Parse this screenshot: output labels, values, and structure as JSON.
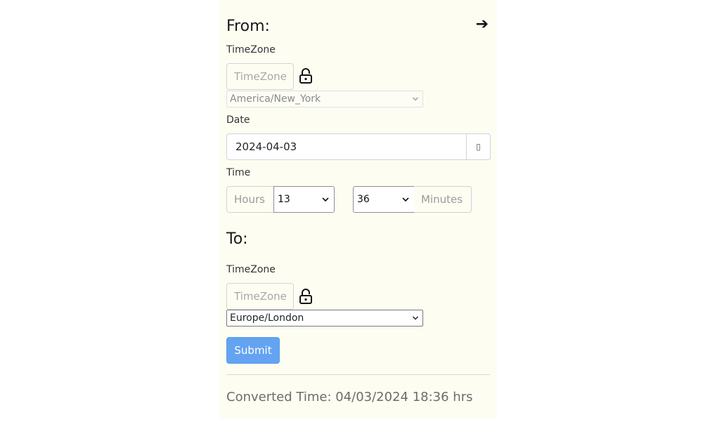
{
  "from": {
    "heading": "From:",
    "arrow": "➔",
    "timezone_label": "TimeZone",
    "timezone_input_placeholder": "TimeZone",
    "timezone_selected": "America/New_York",
    "date_label": "Date",
    "date_value": "2024-04-03",
    "date_button": "▯",
    "time_label": "Time",
    "hours_addon": "Hours",
    "hours_value": "13",
    "minutes_value": "36",
    "minutes_addon": "Minutes"
  },
  "to": {
    "heading": "To:",
    "timezone_label": "TimeZone",
    "timezone_input_placeholder": "TimeZone",
    "timezone_selected": "Europe/London"
  },
  "submit_label": "Submit",
  "result_text": "Converted Time: 04/03/2024 18:36 hrs",
  "colors": {
    "panel_bg": "#fdfdf2",
    "submit_bg": "#64a3f2"
  },
  "icons": {
    "lock": "lock-icon",
    "arrow": "arrow-right-icon",
    "chevron": "chevron-down-icon"
  }
}
